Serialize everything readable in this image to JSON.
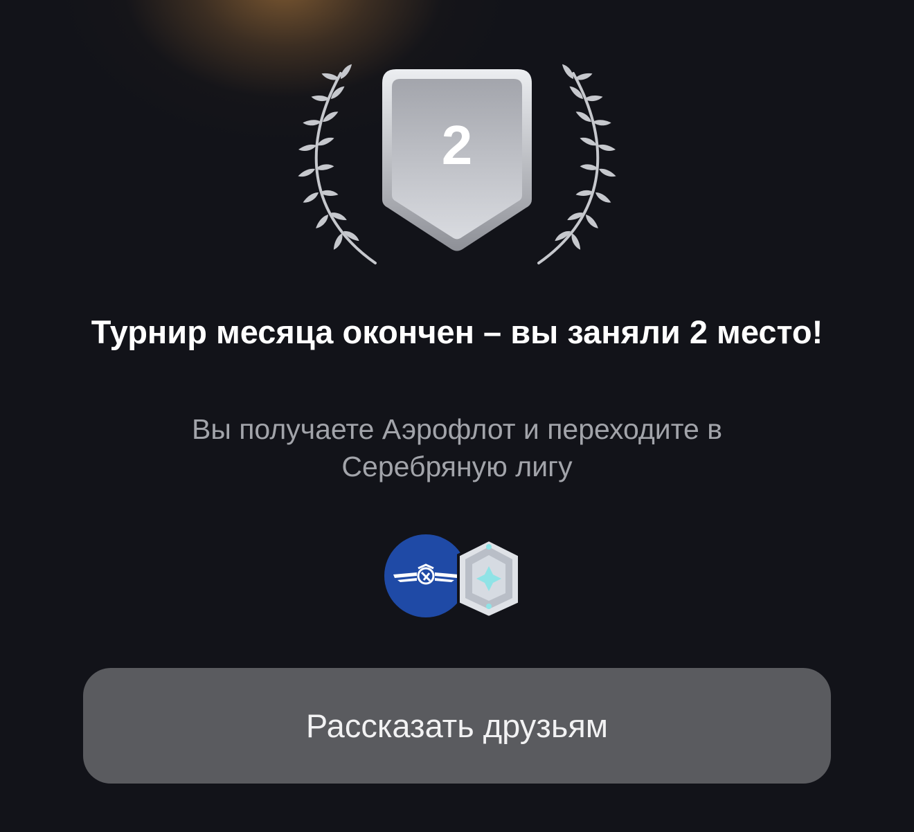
{
  "result": {
    "place_number": "2",
    "title": "Турнир месяца окончен – вы заняли 2 место!",
    "subtitle": "Вы получаете Аэрофлот и переходите в Серебряную лигу"
  },
  "rewards": {
    "partner_icon": "aeroflot-logo-icon",
    "league_icon": "silver-league-icon",
    "partner_color": "#1f4aa6",
    "league_color": "#c9ccd3"
  },
  "actions": {
    "share_label": "Рассказать друзьям"
  },
  "colors": {
    "background": "#121319",
    "glow": "#96693a",
    "badge_silver": "#c8cad0",
    "button": "#5a5b5f"
  }
}
